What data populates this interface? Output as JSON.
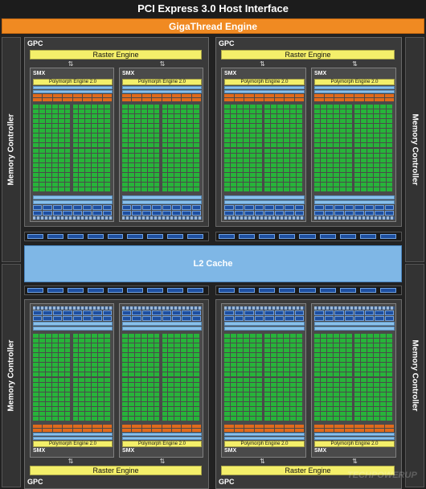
{
  "header": {
    "title": "PCI Express 3.0 Host Interface"
  },
  "giga": {
    "label": "GigaThread Engine"
  },
  "memory_controller": {
    "label": "Memory Controller"
  },
  "gpc": {
    "label": "GPC",
    "raster_label": "Raster Engine"
  },
  "smx": {
    "label": "SMX",
    "polymorph_label": "Polymorph Engine 2.0"
  },
  "l2": {
    "label": "L2 Cache"
  },
  "watermark": {
    "text": "TECHPOWERUP"
  },
  "colors": {
    "core": "#27b43a",
    "core_border": "#1b7a28",
    "orange_unit": "#e06a1c",
    "light_blue": "#89c0ea",
    "dark_blue": "#1e4fa0",
    "yellow": "#f4ef6a",
    "orange": "#f08a22"
  }
}
